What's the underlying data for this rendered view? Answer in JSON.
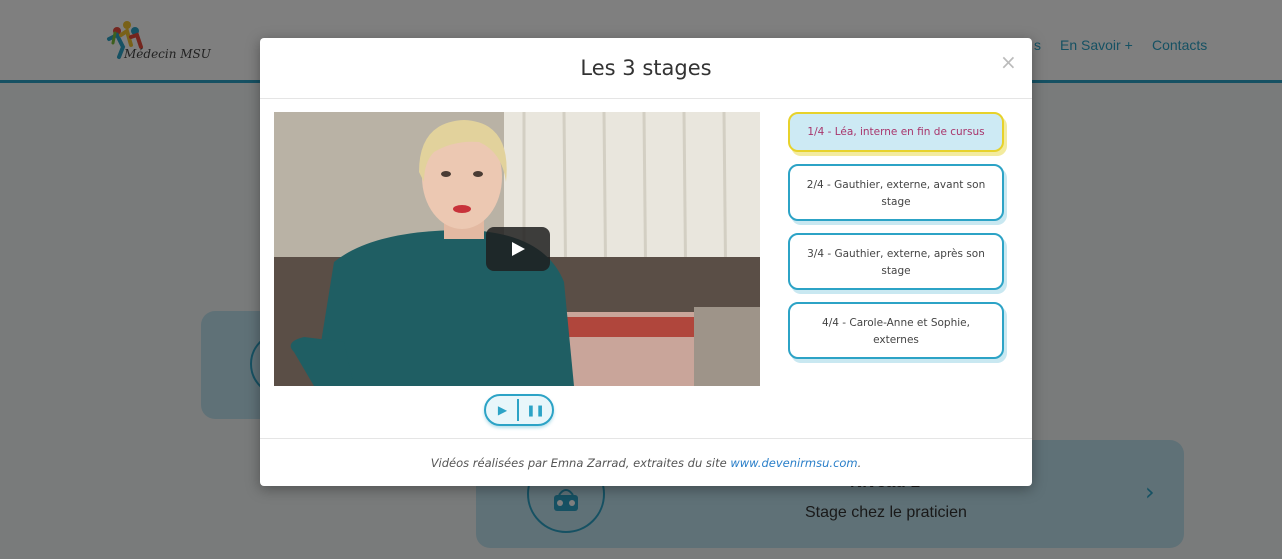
{
  "site": {
    "logo_text": "Médecin MSU",
    "nav_partial": "s",
    "nav_items": [
      "En Savoir +",
      "Contacts"
    ],
    "card_title": "Niveau 1",
    "card_subtitle": "Stage chez le praticien",
    "card_arrow": "›"
  },
  "modal": {
    "title": "Les 3 stages",
    "close": "×",
    "video": {
      "play_icon": "play-icon"
    },
    "controls": {
      "play": "▶",
      "pause": "❚❚"
    },
    "playlist": [
      {
        "label": "1/4 - Léa, interne en fin de cursus",
        "active": true
      },
      {
        "label": "2/4 - Gauthier, externe, avant son stage",
        "active": false
      },
      {
        "label": "3/4 - Gauthier, externe, après son stage",
        "active": false
      },
      {
        "label": "4/4 - Carole-Anne et Sophie, externes",
        "active": false
      }
    ],
    "footer": {
      "text": "Vidéos réalisées par Emna Zarrad, extraites du site ",
      "link": "www.devenirmsu.com",
      "suffix": "."
    }
  },
  "colors": {
    "accent": "#2ca3c6",
    "active_border": "#e7d22b",
    "active_text": "#a8356b",
    "link": "#2a7fc9"
  }
}
